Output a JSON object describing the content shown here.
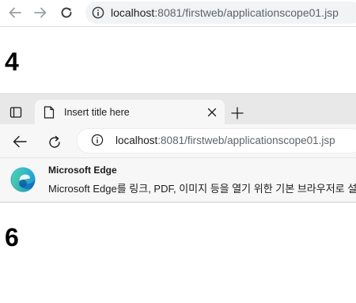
{
  "browser_top": {
    "url_host": "localhost",
    "url_rest": ":8081/firstweb/applicationscope01.jsp"
  },
  "page": {
    "first_value": "4",
    "second_value": "6"
  },
  "edge_window": {
    "tab_title": "Insert title here",
    "url_host": "localhost",
    "url_rest": ":8081/firstweb/applicationscope01.jsp",
    "notice_title": "Microsoft Edge",
    "notice_body": "Microsoft Edge를 링크, PDF, 이미지 등을 열기 위한 기본 브라우저로 설정"
  },
  "icons": [
    "back-arrow-icon",
    "forward-arrow-icon",
    "reload-icon",
    "info-icon",
    "tab-actions-icon",
    "page-icon",
    "close-icon",
    "plus-icon",
    "edge-logo-icon"
  ],
  "colors": {
    "omnibox_bg": "#f1f3f4",
    "edge_chrome_bg": "#f7f7f7",
    "tabstrip_bg": "#e8e8e8"
  }
}
